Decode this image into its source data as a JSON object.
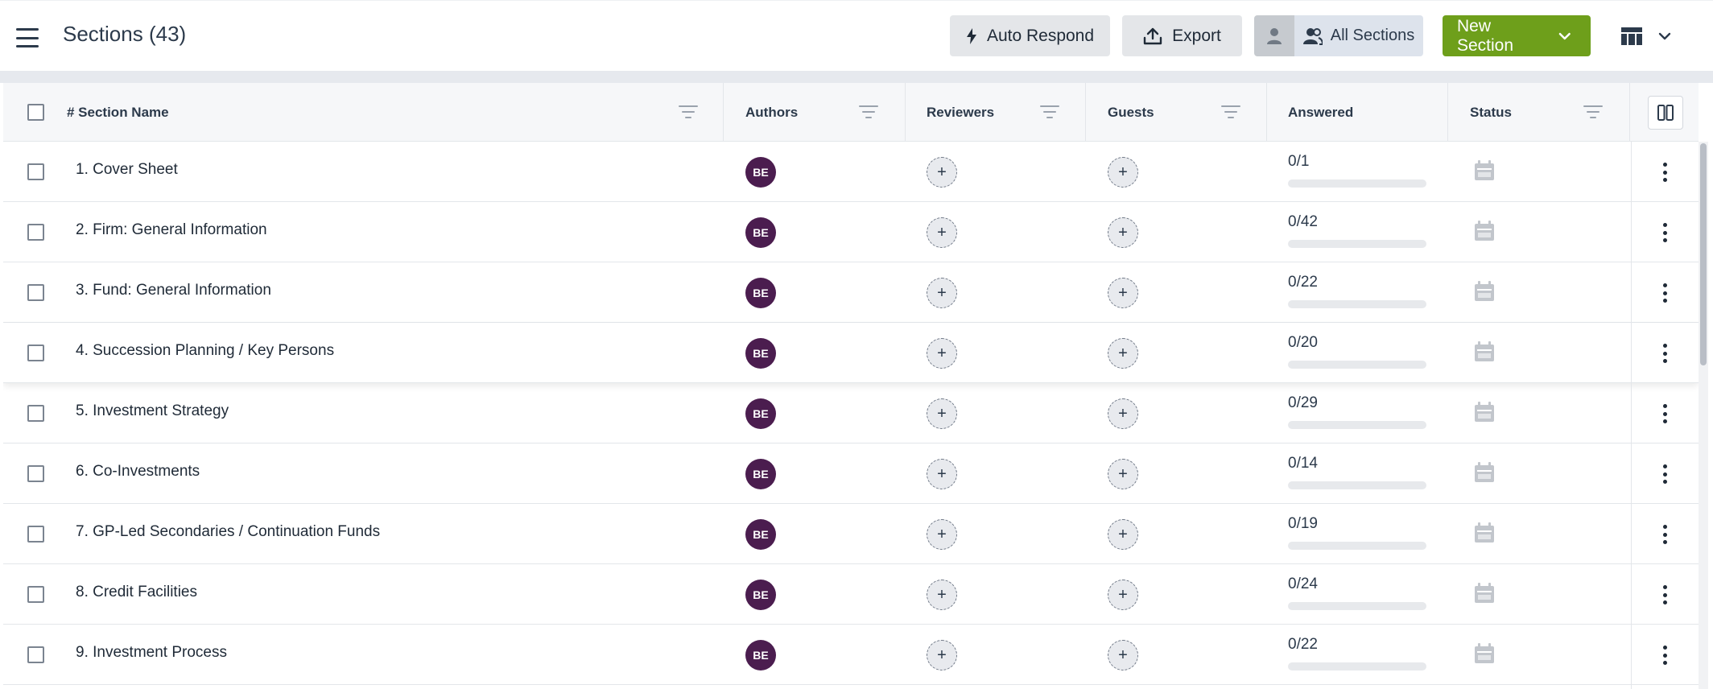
{
  "header": {
    "title": "Sections (43)",
    "auto_respond_label": "Auto Respond",
    "export_label": "Export",
    "all_sections_label": "All Sections",
    "new_section_label": "New Section"
  },
  "columns": {
    "section_name": "# Section Name",
    "authors": "Authors",
    "reviewers": "Reviewers",
    "guests": "Guests",
    "answered": "Answered",
    "status": "Status"
  },
  "colors": {
    "accent_green": "#6e9f1b",
    "avatar_purple": "#4b1d4f",
    "title_text": "#2c3a4b"
  },
  "rows": [
    {
      "name": "1. Cover Sheet",
      "author": "BE",
      "answered": "0/1",
      "progress": 0
    },
    {
      "name": "2. Firm: General Information",
      "author": "BE",
      "answered": "0/42",
      "progress": 0
    },
    {
      "name": "3. Fund: General Information",
      "author": "BE",
      "answered": "0/22",
      "progress": 0
    },
    {
      "name": "4. Succession Planning / Key Persons",
      "author": "BE",
      "answered": "0/20",
      "progress": 0
    },
    {
      "name": "5. Investment Strategy",
      "author": "BE",
      "answered": "0/29",
      "progress": 0
    },
    {
      "name": "6. Co-Investments",
      "author": "BE",
      "answered": "0/14",
      "progress": 0
    },
    {
      "name": "7. GP-Led Secondaries / Continuation Funds",
      "author": "BE",
      "answered": "0/19",
      "progress": 0
    },
    {
      "name": "8. Credit Facilities",
      "author": "BE",
      "answered": "0/24",
      "progress": 0
    },
    {
      "name": "9. Investment Process",
      "author": "BE",
      "answered": "0/22",
      "progress": 0
    }
  ]
}
